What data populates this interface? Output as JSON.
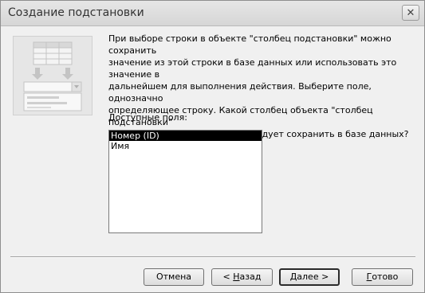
{
  "window": {
    "title": "Создание подстановки"
  },
  "instruction": {
    "text": "При выборе строки в объекте \"столбец подстановки\" можно сохранить\nзначение из этой строки в базе данных или использовать это значение в\nдальнейшем для выполнения действия.  Выберите поле, однозначно\nопределяющее строку.  Какой столбец объекта \"столбец подстановки\"\nсодержит значение, которое следует сохранить в базе данных?"
  },
  "fields": {
    "label": "Доступные поля:",
    "items": [
      {
        "label": "Номер (ID)",
        "selected": true
      },
      {
        "label": "Имя",
        "selected": false
      }
    ]
  },
  "buttons": {
    "cancel": "Отмена",
    "back_prefix": "< ",
    "back_accel": "Н",
    "back_rest": "азад",
    "next_accel": "Д",
    "next_rest": "алее >",
    "finish_accel": "Г",
    "finish_rest": "отово"
  },
  "icons": {
    "close": "close-icon",
    "illustration": "lookup-wizard-illustration"
  }
}
